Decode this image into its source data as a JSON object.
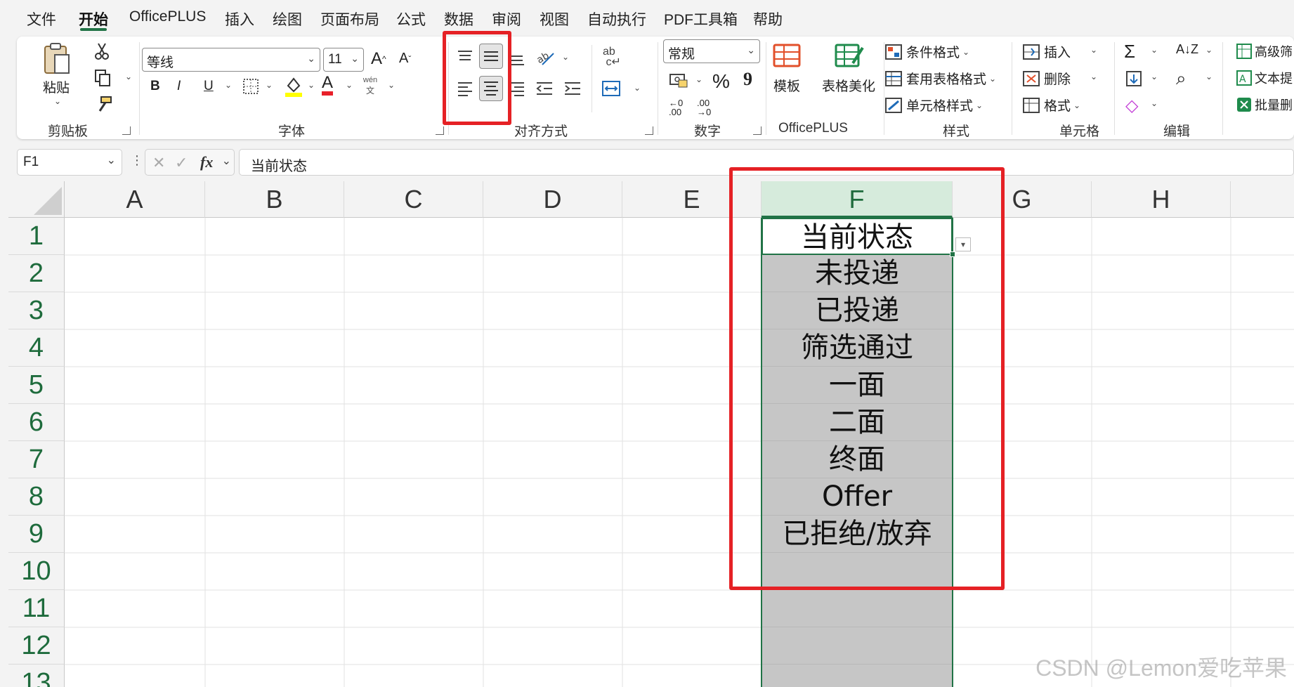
{
  "menu": {
    "tabs": [
      "文件",
      "开始",
      "OfficePLUS",
      "插入",
      "绘图",
      "页面布局",
      "公式",
      "数据",
      "审阅",
      "视图",
      "自动执行",
      "PDF工具箱",
      "帮助"
    ],
    "active": "开始"
  },
  "ribbon": {
    "clipboard": {
      "paste": "粘贴",
      "group": "剪贴板"
    },
    "font": {
      "name": "等线",
      "size": "11",
      "bold": "B",
      "italic": "I",
      "underline": "U",
      "font_color_letter": "A",
      "phonetic_top": "wén",
      "phonetic_bottom": "文",
      "grow": "A^",
      "shrink": "Aˇ",
      "group": "字体"
    },
    "alignment": {
      "group": "对齐方式",
      "wrap_label": "ab"
    },
    "number": {
      "format": "常规",
      "percent": "%",
      "comma": "9",
      "dec_inc": "←0 .00",
      "dec_dec": ".00 →0",
      "group": "数字"
    },
    "officeplus": {
      "template": "模板",
      "table_beautify": "表格美化",
      "group": "OfficePLUS"
    },
    "styles": {
      "conditional": "条件格式",
      "table_format": "套用表格格式",
      "cell_style": "单元格样式",
      "group": "样式"
    },
    "cells": {
      "insert": "插入",
      "delete": "删除",
      "format": "格式",
      "group": "单元格"
    },
    "editing": {
      "sum": "Σ",
      "sort": "A↓Z",
      "find": "⌕",
      "clear": "◇",
      "group": "编辑"
    },
    "extra": {
      "advanced_filter": "高级筛",
      "text_extract": "文本提",
      "batch": "批量删"
    }
  },
  "formula_bar": {
    "name_box": "F1",
    "fx": "fx",
    "content": "当前状态"
  },
  "grid": {
    "columns": [
      "A",
      "B",
      "C",
      "D",
      "E",
      "F",
      "G",
      "H"
    ],
    "rows": [
      "1",
      "2",
      "3",
      "4",
      "5",
      "6",
      "7",
      "8",
      "9",
      "10",
      "11",
      "12",
      "13"
    ],
    "selected_column": "F",
    "f_values": [
      "当前状态",
      "未投递",
      "已投递",
      "筛选通过",
      "一面",
      "二面",
      "终面",
      "Offer",
      "已拒绝/放弃",
      "",
      "",
      "",
      ""
    ]
  },
  "watermark": "CSDN @Lemon爱吃苹果",
  "colors": {
    "accent": "#217346",
    "highlight": "#e52125",
    "cell_fill": "#c6c6c6"
  }
}
